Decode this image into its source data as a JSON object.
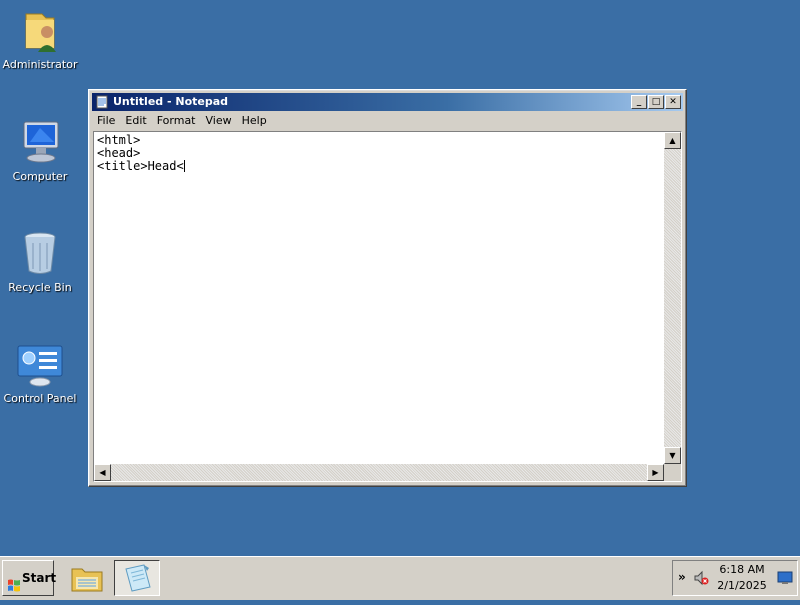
{
  "desktop": {
    "icons": [
      {
        "label": "Administrator",
        "icon": "user-folder-icon"
      },
      {
        "label": "Computer",
        "icon": "computer-icon"
      },
      {
        "label": "Recycle Bin",
        "icon": "recycle-bin-icon"
      },
      {
        "label": "Control Panel",
        "icon": "control-panel-icon"
      }
    ]
  },
  "window": {
    "title": "Untitled - Notepad",
    "controls": {
      "minimize": "_",
      "maximize": "□",
      "close": "✕"
    },
    "menu": [
      "File",
      "Edit",
      "Format",
      "View",
      "Help"
    ],
    "content": "<html>\n<head>\n<title>Head<"
  },
  "taskbar": {
    "start_label": "Start",
    "buttons": [
      {
        "name": "explorer",
        "icon": "folder-icon"
      },
      {
        "name": "notepad",
        "icon": "notepad-icon",
        "active": true
      }
    ],
    "tray": {
      "chevron": "»",
      "time": "6:18 AM",
      "date": "2/1/2025"
    }
  },
  "colors": {
    "desktop": "#3a6ea5",
    "titlebar_start": "#0a246a",
    "titlebar_end": "#a6caf0",
    "chrome": "#d4d0c8"
  }
}
